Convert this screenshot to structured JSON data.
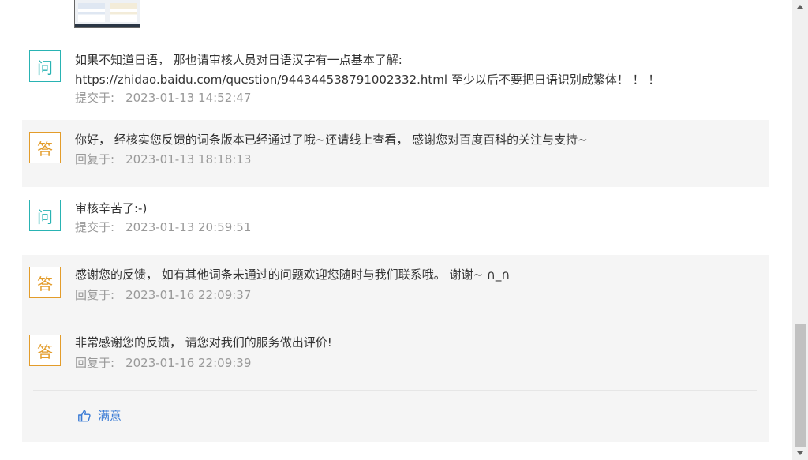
{
  "messages": [
    {
      "badge": "问",
      "text_line1": "如果不知道日语， 那也请审核人员对日语汉字有一点基本了解:",
      "text_line2": "https://zhidao.baidu.com/question/944344538791002332.html 至少以后不要把日语识别成繁体！ ！ ！",
      "meta_label": "提交于:",
      "meta_time": "2023-01-13 14:52:47"
    },
    {
      "badge": "答",
      "text_line1": "你好， 经核实您反馈的词条版本已经通过了哦~还请线上查看， 感谢您对百度百科的关注与支持~",
      "meta_label": "回复于:",
      "meta_time": "2023-01-13 18:18:13"
    },
    {
      "badge": "问",
      "text_line1": "审核辛苦了:-)",
      "meta_label": "提交于:",
      "meta_time": "2023-01-13 20:59:51"
    },
    {
      "badge": "答",
      "text_line1": "感谢您的反馈， 如有其他词条未通过的问题欢迎您随时与我们联系哦。 谢谢~ ∩_∩",
      "meta_label": "回复于:",
      "meta_time": "2023-01-16 22:09:37"
    },
    {
      "badge": "答",
      "text_line1": "非常感谢您的反馈， 请您对我们的服务做出评价!",
      "meta_label": "回复于:",
      "meta_time": "2023-01-16 22:09:39"
    }
  ],
  "rating": {
    "label": "满意",
    "icon": "thumbs-up-icon"
  },
  "colors": {
    "question_accent": "#29b3b3",
    "answer_accent": "#e39c2a",
    "link_blue": "#3a7bd5",
    "answer_bg": "#f5f5f5"
  }
}
